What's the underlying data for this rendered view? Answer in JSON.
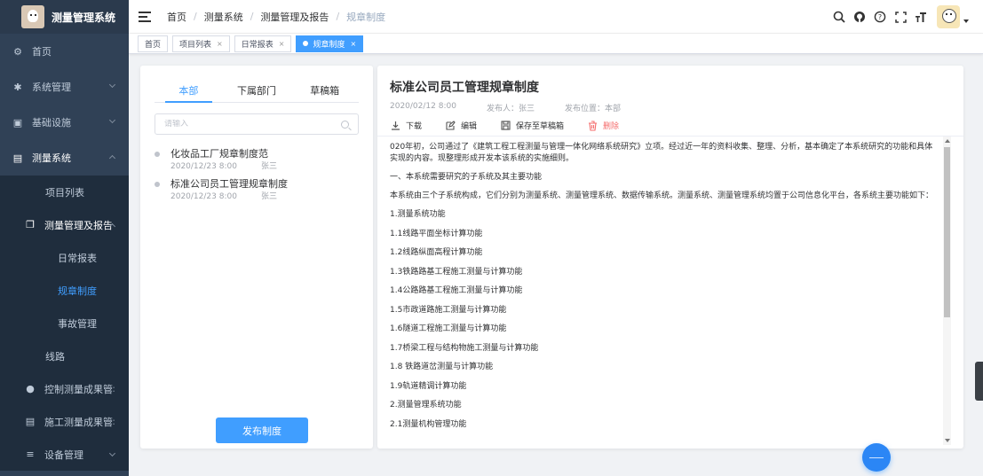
{
  "app": {
    "title": "测量管理系统"
  },
  "sidebar": {
    "items": [
      {
        "label": "首页",
        "icon": "dashboard-icon"
      },
      {
        "label": "系统管理",
        "icon": "gear-icon"
      },
      {
        "label": "基础设施",
        "icon": "monitor-icon"
      },
      {
        "label": "测量系统",
        "icon": "document-icon"
      },
      {
        "label": "项目列表"
      },
      {
        "label": "测量管理及报告",
        "icon": "copy-icon"
      },
      {
        "label": "日常报表"
      },
      {
        "label": "规章制度"
      },
      {
        "label": "事故管理"
      },
      {
        "label": "线路"
      },
      {
        "label": "控制测量成果管",
        "icon": "gauge-icon"
      },
      {
        "label": "施工测量成果管",
        "icon": "document-icon"
      },
      {
        "label": "设备管理",
        "icon": "sliders-icon"
      }
    ]
  },
  "breadcrumb": [
    "首页",
    "测量系统",
    "测量管理及报告",
    "规章制度"
  ],
  "tags": [
    {
      "label": "首页"
    },
    {
      "label": "项目列表"
    },
    {
      "label": "日常报表"
    },
    {
      "label": "规章制度"
    }
  ],
  "left": {
    "tabs": [
      "本部",
      "下属部门",
      "草稿箱"
    ],
    "search_placeholder": "请输入",
    "docs": [
      {
        "title": "化妆品工厂规章制度范",
        "date": "2020/12/23  8:00",
        "author": "张三"
      },
      {
        "title": "标准公司员工管理规章制度",
        "date": "2020/12/23  8:00",
        "author": "张三"
      }
    ],
    "publish_label": "发布制度"
  },
  "doc": {
    "title": "标准公司员工管理规章制度",
    "date": "2020/02/12  8:00",
    "publisher": "发布人：张三",
    "location": "发布位置：本部",
    "actions": {
      "download": "下载",
      "edit": "编辑",
      "save_draft": "保存至草稿箱",
      "delete": "删除"
    },
    "paragraphs": [
      "020年初，公司通过了《建筑工程工程测量与管理一体化网络系统研究》立项。经过近一年的资料收集、整理、分析，基本确定了本系统研究的功能和具体实现的内容。现整理形成开发本该系统的实施细则。",
      "一、本系统需要研究的子系统及其主要功能",
      "本系统由三个子系统构成，它们分别为测量系统、测量管理系统、数据传输系统。测量系统、测量管理系统均置于公司信息化平台，各系统主要功能如下：",
      "1.测量系统功能",
      "1.1线路平面坐标计算功能",
      "1.2线路纵面高程计算功能",
      "1.3铁路路基工程施工测量与计算功能",
      "1.4公路路基工程施工测量与计算功能",
      "1.5市政道路施工测量与计算功能",
      "1.6隧道工程施工测量与计算功能",
      "1.7桥梁工程与结构物施工测量与计算功能",
      "1.8 铁路道岔测量与计算功能",
      "1.9轨道精调计算功能",
      "2.测量管理系统功能",
      "2.1测量机构管理功能"
    ]
  },
  "colors": {
    "sidebar_bg": "#304156",
    "primary": "#409eff",
    "danger": "#f56c6c"
  }
}
